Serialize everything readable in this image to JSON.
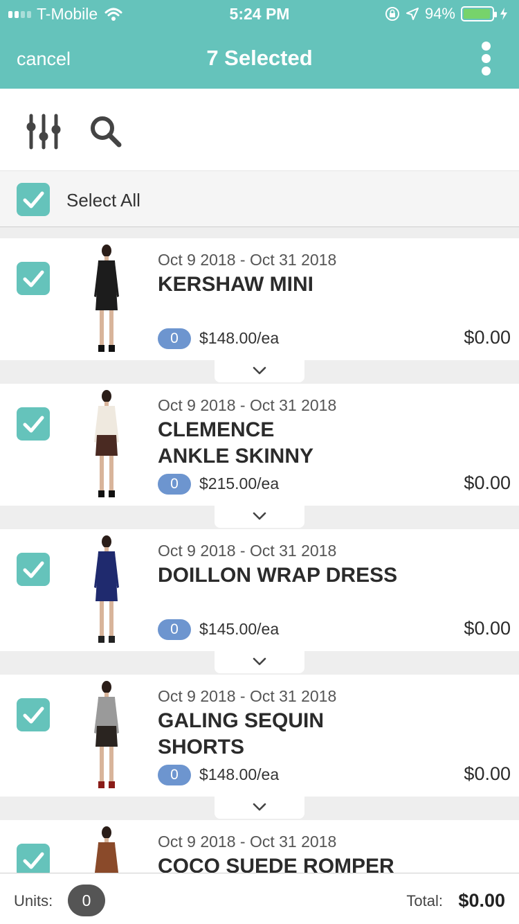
{
  "status_bar": {
    "carrier": "T-Mobile",
    "time": "5:24 PM",
    "battery_percent": "94%",
    "battery_level": 0.94,
    "icons": [
      "signal-icon",
      "wifi-icon",
      "orientation-lock-icon",
      "location-icon",
      "battery-icon",
      "charging-icon"
    ]
  },
  "nav": {
    "cancel_label": "cancel",
    "title": "7 Selected",
    "more_icon": "more-vertical-icon"
  },
  "toolbar": {
    "icons": [
      "filter-sliders-icon",
      "search-icon"
    ]
  },
  "select_all": {
    "label": "Select All",
    "checked": true
  },
  "items": [
    {
      "dates": "Oct 9 2018 - Oct 31 2018",
      "name_lines": [
        "KERSHAW MINI"
      ],
      "qty": "0",
      "price": "$148.00/ea",
      "subtotal": "$0.00",
      "checked": true,
      "colors": {
        "top": "#1c1c1c",
        "bottom": "#1c1c1c",
        "shoes": "#111111"
      }
    },
    {
      "dates": "Oct 9 2018 - Oct 31 2018",
      "name_lines": [
        "CLEMENCE",
        "ANKLE SKINNY"
      ],
      "qty": "0",
      "price": "$215.00/ea",
      "subtotal": "$0.00",
      "checked": true,
      "colors": {
        "top": "#efe9df",
        "bottom": "#4a2a22",
        "shoes": "#111111"
      }
    },
    {
      "dates": "Oct 9 2018 - Oct 31 2018",
      "name_lines": [
        "DOILLON WRAP DRESS"
      ],
      "qty": "0",
      "price": "$145.00/ea",
      "subtotal": "$0.00",
      "checked": true,
      "colors": {
        "top": "#1f2a6e",
        "bottom": "#1f2a6e",
        "shoes": "#222222"
      }
    },
    {
      "dates": "Oct 9 2018 - Oct 31 2018",
      "name_lines": [
        "GALING SEQUIN",
        "SHORTS"
      ],
      "qty": "0",
      "price": "$148.00/ea",
      "subtotal": "$0.00",
      "checked": true,
      "colors": {
        "top": "#9a9a9a",
        "bottom": "#2a2420",
        "shoes": "#8a1c18"
      }
    },
    {
      "dates": "Oct 9 2018 - Oct 31 2018",
      "name_lines": [
        "COCO SUEDE ROMPER"
      ],
      "qty": "",
      "price": "",
      "subtotal": "",
      "checked": true,
      "colors": {
        "top": "#8a4a2a",
        "bottom": "#8a4a2a",
        "shoes": "#5a3020"
      }
    }
  ],
  "footer": {
    "units_label": "Units:",
    "units_count": "0",
    "total_label": "Total:",
    "total_value": "$0.00"
  },
  "colors": {
    "accent": "#65c3bb",
    "qty_badge": "#6d95cf",
    "battery_fill": "#77d36b"
  }
}
